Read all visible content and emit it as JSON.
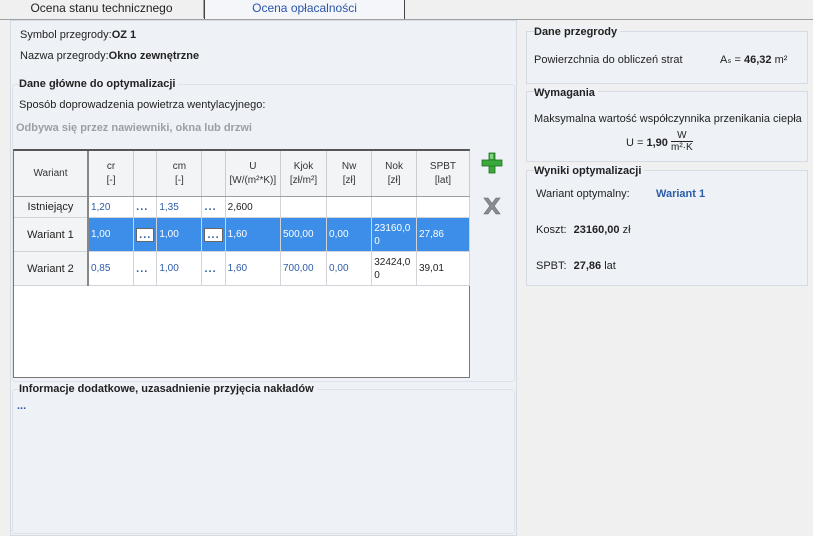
{
  "tabs": [
    {
      "label": "Ocena stanu technicznego"
    },
    {
      "label": "Ocena opłacalności"
    }
  ],
  "left": {
    "symbol_label": "Symbol przegrody:",
    "symbol_value": "OZ 1",
    "name_label": "Nazwa przegrody:",
    "name_value": "Okno zewnętrzne",
    "main_group_title": "Dane główne do optymalizacji",
    "ventilation_label": "Sposób doprowadzenia powietrza wentylacyjnego:",
    "ventilation_value": "Odbywa się przez nawiewniki, okna lub drzwi",
    "info_group_title": "Informacje dodatkowe, uzasadnienie przyjęcia nakładów",
    "info_value": "..."
  },
  "grid": {
    "columns": [
      {
        "name": "Wariant",
        "unit": ""
      },
      {
        "name": "cr",
        "unit": "[-]"
      },
      {
        "name": "",
        "unit": ""
      },
      {
        "name": "cm",
        "unit": "[-]"
      },
      {
        "name": "",
        "unit": ""
      },
      {
        "name": "U",
        "unit": "[W/(m²*K)]"
      },
      {
        "name": "Kjok",
        "unit": "[zł/m²]"
      },
      {
        "name": "Nw",
        "unit": "[zł]"
      },
      {
        "name": "Nok",
        "unit": "[zł]"
      },
      {
        "name": "SPBT",
        "unit": "[lat]"
      }
    ],
    "rows": [
      {
        "name": "Istniejący",
        "cr": "1,20",
        "cm": "1,35",
        "u": "2,600",
        "kjok": "",
        "nw": "",
        "nok": "",
        "spbt": ""
      },
      {
        "name": "Wariant 1",
        "cr": "1,00",
        "cm": "1,00",
        "u": "1,60",
        "kjok": "500,00",
        "nw": "0,00",
        "nok": "23160,00",
        "spbt": "27,86"
      },
      {
        "name": "Wariant 2",
        "cr": "0,85",
        "cm": "1,00",
        "u": "1,60",
        "kjok": "700,00",
        "nw": "0,00",
        "nok": "32424,00",
        "spbt": "39,01"
      }
    ],
    "dots": "..."
  },
  "right": {
    "dane_title": "Dane przegrody",
    "area_label": "Powierzchnia do obliczeń strat",
    "area_symbol": "Aₛ",
    "area_value": "46,32",
    "area_unit": "m²",
    "req_title": "Wymagania",
    "req_label": "Maksymalna wartość współczynnika przenikania ciepła",
    "req_u": "U = ",
    "req_value": "1,90",
    "req_unit_num": "W",
    "req_unit_den": "m²·K",
    "res_title": "Wyniki optymalizacji",
    "opt_label": "Wariant optymalny:",
    "opt_value": "Wariant 1",
    "cost_label": "Koszt:",
    "cost_value": "23160,00",
    "cost_unit": "zł",
    "spbt_label": "SPBT:",
    "spbt_value": "27,86",
    "spbt_unit": "lat"
  },
  "colors": {
    "accent": "#2d5ca8",
    "selection": "#3d8ee8",
    "add_icon": "#3aa83a",
    "delete_icon": "#8a8f96"
  }
}
